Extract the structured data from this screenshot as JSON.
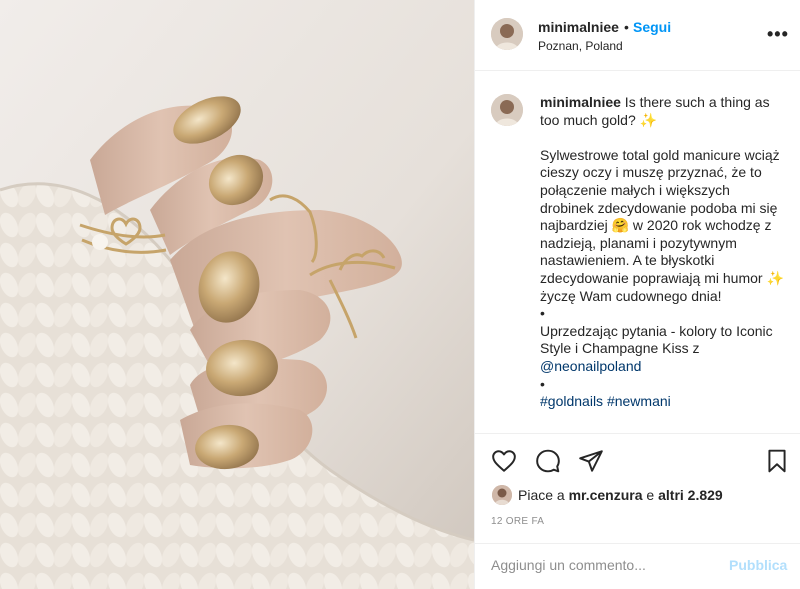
{
  "post": {
    "image_alt": "gold glitter nails",
    "header": {
      "username": "minimalniee",
      "dot": "•",
      "follow_label": "Segui",
      "location": "Poznan, Poland",
      "more_icon": "more-horizontal-icon"
    },
    "caption": {
      "username": "minimalniee",
      "line1": " Is there such a thing as too much gold? ✨",
      "body": "Sylwestrowe total gold manicure wciąż cieszy oczy i muszę przyznać, że to połączenie małych i większych drobinek zdecydowanie podoba mi się najbardziej 🤗 w 2020 rok wchodzę z nadzieją, planami i pozytywnym nastawieniem. A te błyskotki zdecydowanie poprawiają mi humor ✨ życzę Wam cudownego dnia!",
      "bullet1": "•",
      "body2": "Uprzedzając pytania - kolory to Iconic Style i Champagne Kiss z ",
      "mention": "@neonailpoland",
      "bullet2": "•",
      "hashtags": "#goldnails #newmani"
    },
    "actions": {
      "like_icon": "heart-icon",
      "comment_icon": "comment-icon",
      "share_icon": "send-icon",
      "save_icon": "bookmark-icon"
    },
    "likes": {
      "prefix": "Piace a ",
      "user": "mr.cenzura",
      "middle": " e ",
      "others": "altri 2.829"
    },
    "time": "12 ORE FA",
    "comment": {
      "placeholder": "Aggiungi un commento...",
      "publish_label": "Pubblica"
    }
  }
}
